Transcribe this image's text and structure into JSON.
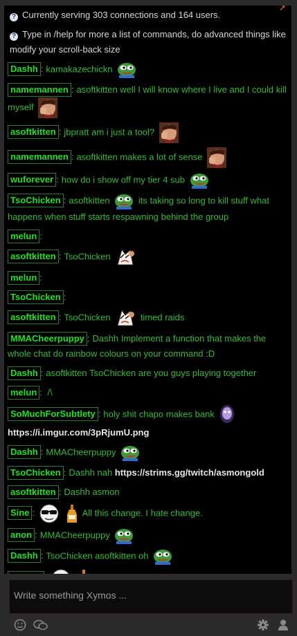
{
  "info": [
    {
      "text": "Currently serving 303 connections and 164 users."
    },
    {
      "text": "Type in /help for more a list of commands, do advanced things like modify your scroll-back size"
    }
  ],
  "messages": [
    {
      "user": "Dashh",
      "parts": [
        {
          "t": "text",
          "v": "kamakazechickn"
        },
        {
          "t": "emote",
          "name": "pepe-emote"
        }
      ]
    },
    {
      "user": "namemannen",
      "parts": [
        {
          "t": "text",
          "v": "asoftkitten well I will know where I live and I could kill myself"
        },
        {
          "t": "emote",
          "name": "facepalm-emote"
        }
      ]
    },
    {
      "user": "asoftkitten",
      "parts": [
        {
          "t": "text",
          "v": "jbpratt am i just a tool?"
        },
        {
          "t": "emote",
          "name": "facepalm-emote"
        }
      ]
    },
    {
      "user": "namemannen",
      "parts": [
        {
          "t": "text",
          "v": "asoftkitten makes a lot of sense"
        },
        {
          "t": "emote",
          "name": "facepalm-emote"
        }
      ]
    },
    {
      "user": "wuforever",
      "parts": [
        {
          "t": "text",
          "v": "how do i show off my tier 4 sub"
        },
        {
          "t": "emote",
          "name": "pepe-emote"
        }
      ]
    },
    {
      "user": "TsoChicken",
      "parts": [
        {
          "t": "text",
          "v": "asoftkitten"
        },
        {
          "t": "emote",
          "name": "pepe-emote"
        },
        {
          "t": "text",
          "v": "its taking so long to kill stuff what happens when stuff starts respawning behind the group"
        }
      ]
    },
    {
      "user": "melun",
      "parts": []
    },
    {
      "user": "asoftkitten",
      "parts": [
        {
          "t": "text",
          "v": "TsoChicken"
        },
        {
          "t": "emote",
          "name": "cat-emote"
        }
      ]
    },
    {
      "user": "melun",
      "parts": []
    },
    {
      "user": "TsoChicken",
      "parts": []
    },
    {
      "user": "asoftkitten",
      "parts": [
        {
          "t": "text",
          "v": "TsoChicken"
        },
        {
          "t": "emote",
          "name": "cat-emote"
        },
        {
          "t": "text",
          "v": "timed raids"
        }
      ]
    },
    {
      "user": "MMACheerpuppy",
      "parts": [
        {
          "t": "text",
          "v": "Dashh Implement a function that makes the whole chat do rainbow colours on your command :D"
        }
      ]
    },
    {
      "user": "Dashh",
      "parts": [
        {
          "t": "text",
          "v": "asoftkitten TsoChicken are you guys playing together"
        }
      ]
    },
    {
      "user": "melun",
      "parts": [
        {
          "t": "text",
          "v": "    /\\"
        }
      ]
    },
    {
      "user": "SoMuchForSubtlety",
      "parts": [
        {
          "t": "text",
          "v": "holy shit chapo makes bank"
        },
        {
          "t": "emote",
          "name": "ghost-emote"
        },
        {
          "t": "link",
          "v": "https://i.imgur.com/3pRjumU.png"
        }
      ]
    },
    {
      "user": "Dashh",
      "parts": [
        {
          "t": "text",
          "v": "MMACheerpuppy"
        },
        {
          "t": "emote",
          "name": "pepe-emote"
        }
      ]
    },
    {
      "user": "TsoChicken",
      "parts": [
        {
          "t": "text",
          "v": "Dashh nah"
        },
        {
          "t": "link",
          "v": "https://strims.gg/twitch/asmongold"
        }
      ]
    },
    {
      "user": "asoftkitten",
      "parts": [
        {
          "t": "text",
          "v": "Dashh asmon"
        }
      ]
    },
    {
      "user": "Sine",
      "parts": [
        {
          "t": "emote",
          "name": "sunglasses-emote"
        },
        {
          "t": "emote",
          "name": "beer-emote"
        },
        {
          "t": "text",
          "v": "All this change. I hate change."
        }
      ]
    },
    {
      "user": "anon",
      "parts": [
        {
          "t": "text",
          "v": "MMACheerpuppy"
        },
        {
          "t": "emote",
          "name": "pepe-emote"
        }
      ]
    },
    {
      "user": "Dashh",
      "parts": [
        {
          "t": "text",
          "v": "TsoChicken asoftkitten oh"
        },
        {
          "t": "emote",
          "name": "pepe-emote"
        }
      ]
    },
    {
      "user": "Boocra",
      "parts": [
        {
          "t": "emote",
          "name": "sunglasses-emote"
        },
        {
          "t": "emote",
          "name": "beer-emote"
        }
      ]
    }
  ],
  "input": {
    "placeholder": "Write something Xymos ..."
  },
  "colors": {
    "username": "#21e021",
    "message": "#36b836",
    "link": "#e6e6e6",
    "background": "#000000"
  }
}
